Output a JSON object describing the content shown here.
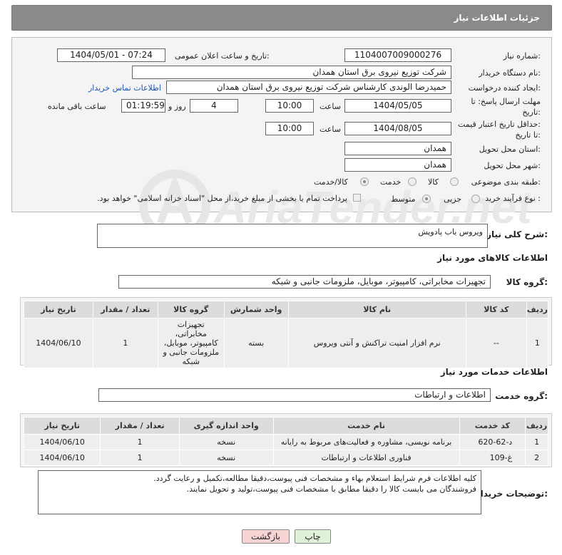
{
  "header": {
    "title": "جزئیات اطلاعات نیاز"
  },
  "form": {
    "need_number_label": "شماره نیاز:",
    "need_number": "1104007009000276",
    "announce_label": "تاریخ و ساعت اعلان عمومی:",
    "announce_value": "1404/05/01 - 07:24",
    "buyer_label": "نام دستگاه خریدار:",
    "buyer_value": "شرکت توزیع نیروی برق استان همدان",
    "creator_label": "ایجاد کننده درخواست:",
    "creator_value": "حمیدرضا الوندی کارشناس شرکت توزیع نیروی برق استان همدان",
    "contact_link": "اطلاعات تماس خریدار",
    "deadline_label_1": "مهلت ارسال پاسخ: تا",
    "deadline_label_2": "تاریخ:",
    "deadline_date": "1404/05/05",
    "hour_label": "ساعت",
    "deadline_hour": "10:00",
    "days_value": "4",
    "days_label": "روز و",
    "remaining_time": "01:19:59",
    "remaining_label": "ساعت باقی مانده",
    "validity_label_1": "حداقل تاریخ اعتبار قیمت:",
    "validity_label_2": "تا تاریخ:",
    "validity_date": "1404/08/05",
    "validity_hour": "10:00",
    "province_label": "استان محل تحویل:",
    "province_value": "همدان",
    "city_label": "شهر محل تحویل:",
    "city_value": "همدان",
    "category_label": "طبقه بندی موضوعی:",
    "category_options": [
      "کالا",
      "خدمت",
      "کالا/خدمت"
    ],
    "category_selected": "کالا/خدمت",
    "process_label": "نوع فرآیند خرید :",
    "process_options": [
      "جزیی",
      "متوسط"
    ],
    "process_selected": "متوسط",
    "payment_note": "پرداخت تمام یا بخشی از مبلغ خرید،از محل \"اسناد خزانه اسلامی\" خواهد بود."
  },
  "summary": {
    "label": "شرح کلی نیاز:",
    "value": "ویروس یاب پادویش"
  },
  "goods": {
    "heading": "اطلاعات کالاهای مورد نیاز",
    "group_label": "گروه کالا:",
    "group_value": "تجهیزات مخابراتی، کامپیوتر، موبایل، ملزومات جانبی و شبکه",
    "columns": [
      "ردیف",
      "کد کالا",
      "نام کالا",
      "واحد شمارش",
      "گروه کالا",
      "تعداد / مقدار",
      "تاریخ نیاز"
    ],
    "rows": [
      [
        "1",
        "--",
        "نرم افزار امنیت تراکنش و آنتی ویروس",
        "بسته",
        "تجهیزات مخابراتی، کامپیوتر، موبایل، ملزومات جانبی و شبکه",
        "1",
        "1404/06/10"
      ]
    ]
  },
  "services": {
    "heading": "اطلاعات خدمات مورد نیاز",
    "group_label": "گروه خدمت:",
    "group_value": "اطلاعات و ارتباطات",
    "columns": [
      "ردیف",
      "کد خدمت",
      "نام خدمت",
      "واحد اندازه گیری",
      "تعداد / مقدار",
      "تاریخ نیاز"
    ],
    "rows": [
      [
        "1",
        "د-62-620",
        "برنامه نویسی، مشاوره و فعالیت‌های مربوط به رایانه",
        "نسخه",
        "1",
        "1404/06/10"
      ],
      [
        "2",
        "غ-109",
        "فناوری اطلاعات و ارتباطات",
        "نسخه",
        "1",
        "1404/06/10"
      ]
    ]
  },
  "buyer_notes": {
    "label": "توضیحات خریدار:",
    "lines": [
      "کلیه اطلاعات فرم شرایط استعلام بهاء و مشخصات فنی پیوست،دقیقا مطالعه،تکمیل و رعایت گردد.",
      "فروشندگان می بایست کالا را دقیقا مطابق با مشخصات فنی پیوست،تولید و تحویل نمایند."
    ]
  },
  "buttons": {
    "print": "چاپ",
    "back": "بازگشت"
  },
  "watermark": "AriaTender.net",
  "colors": {
    "header_bg": "#8a8a8a",
    "link": "#1a56b8",
    "print_btn": "#dff2d8",
    "back_btn": "#f6d4d4"
  }
}
